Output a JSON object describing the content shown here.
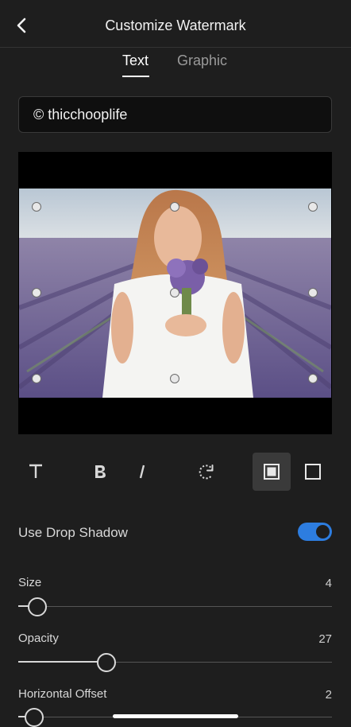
{
  "header": {
    "title": "Customize Watermark",
    "back_icon": "chevron-left-icon"
  },
  "tabs": [
    {
      "label": "Text",
      "active": true
    },
    {
      "label": "Graphic",
      "active": false
    }
  ],
  "watermark_text": {
    "value": "© thicchooplife"
  },
  "toolbar": {
    "tools": [
      {
        "icon": "text-style-icon",
        "glyph": "T"
      },
      {
        "icon": "bold-icon",
        "glyph": "B"
      },
      {
        "icon": "italic-icon",
        "glyph": "I"
      },
      {
        "icon": "rotate-icon"
      },
      {
        "icon": "filled-box-icon",
        "selected": true
      },
      {
        "icon": "outline-box-icon",
        "selected": false
      }
    ]
  },
  "drop_shadow": {
    "label": "Use Drop Shadow",
    "enabled": true
  },
  "sliders": {
    "size": {
      "label": "Size",
      "value": "4",
      "fraction": 0.06
    },
    "opacity": {
      "label": "Opacity",
      "value": "27",
      "fraction": 0.28
    },
    "horizontal_offset": {
      "label": "Horizontal Offset",
      "value": "2",
      "fraction": 0.05
    }
  },
  "colors": {
    "accent": "#2d7de0",
    "background": "#1e1e1e"
  }
}
